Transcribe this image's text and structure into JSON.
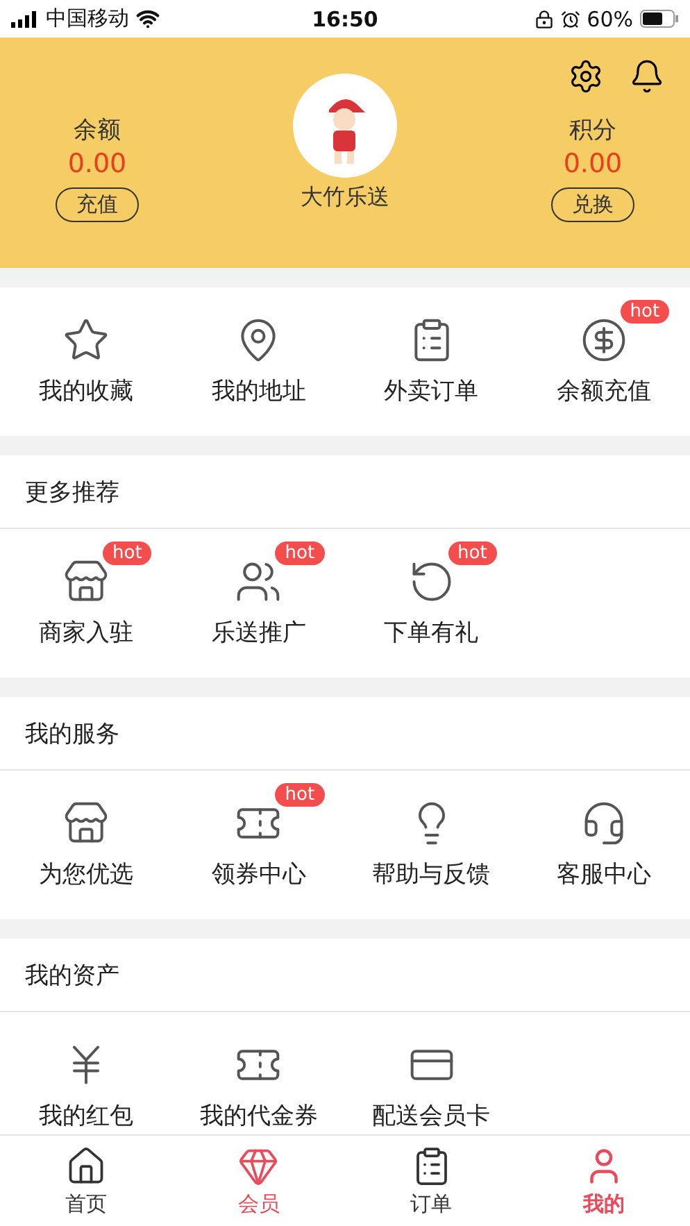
{
  "status_bar": {
    "carrier": "中国移动",
    "time": "16:50",
    "battery": "60%"
  },
  "header": {
    "balance": {
      "label": "余额",
      "value": "0.00",
      "button": "充值"
    },
    "name": "大竹乐送",
    "points": {
      "label": "积分",
      "value": "0.00",
      "button": "兑换"
    }
  },
  "quick_actions": [
    {
      "label": "我的收藏"
    },
    {
      "label": "我的地址"
    },
    {
      "label": "外卖订单"
    },
    {
      "label": "余额充值",
      "badge": "hot"
    }
  ],
  "sections": [
    {
      "title": "更多推荐",
      "items": [
        {
          "label": "商家入驻",
          "badge": "hot"
        },
        {
          "label": "乐送推广",
          "badge": "hot"
        },
        {
          "label": "下单有礼",
          "badge": "hot"
        }
      ]
    },
    {
      "title": "我的服务",
      "items": [
        {
          "label": "为您优选"
        },
        {
          "label": "领券中心",
          "badge": "hot"
        },
        {
          "label": "帮助与反馈"
        },
        {
          "label": "客服中心"
        }
      ]
    },
    {
      "title": "我的资产",
      "items": [
        {
          "label": "我的红包"
        },
        {
          "label": "我的代金券"
        },
        {
          "label": "配送会员卡"
        }
      ]
    }
  ],
  "tab_bar": [
    {
      "label": "首页",
      "selected": false,
      "color": "#333333"
    },
    {
      "label": "会员",
      "selected": false,
      "color": "#e84c5c"
    },
    {
      "label": "订单",
      "selected": false,
      "color": "#333333"
    },
    {
      "label": "我的",
      "selected": true,
      "color": "#e84c5c"
    }
  ]
}
